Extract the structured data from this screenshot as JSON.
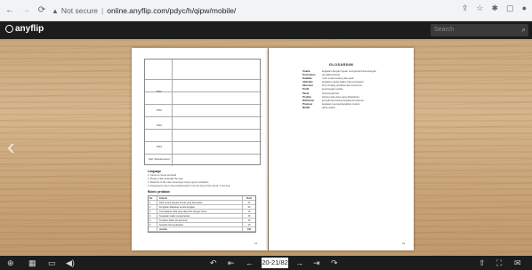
{
  "browser": {
    "security_label": "Not secure",
    "url": "online.anyflip.com/pdyc/h/qipw/mobile/"
  },
  "app": {
    "logo_text": "anyflip",
    "search_placeholder": "Search"
  },
  "book": {
    "left_page": {
      "row_labels": [
        "PS1",
        "PS2",
        "PS3",
        "PS4",
        "Rel. Requirement"
      ],
      "section_heading": "Language",
      "list_items": [
        "1. Carnet a course and lead",
        "2. Please make wnatually the task",
        "3. Read the to the rules stereotype using a given evaluation",
        "4. Assessment note to the portfolio basin to the the time of the record. In the time"
      ],
      "rubric_heading": "Rubric penilaian",
      "rubric_header": [
        "No",
        "Kriteria",
        "Point"
      ],
      "rubric_rows": [
        [
          "1",
          "Data sesuai dengan format yang ditentukan",
          "20"
        ],
        [
          "2",
          "Pengisian dilakukan secara lengkap",
          "20"
        ],
        [
          "3",
          "Kelengkapan data yang diperoleh dengan benar",
          "15"
        ],
        [
          "4",
          "Ketepatan waktu pengumpulan",
          "15"
        ],
        [
          "5",
          "Kerapian dalam penyusunan",
          "15"
        ],
        [
          "6",
          "Keaslian hasil pekerjaan",
          "15"
        ],
        [
          "",
          "Jumlah",
          "100"
        ]
      ],
      "page_number": "21"
    },
    "right_page": {
      "title": "GLOSARIUM",
      "glossary": [
        [
          "Usaha",
          "kegiatan dengan tujuan memperoleh keuntungan"
        ],
        [
          "Konsumen",
          "pemakai barang"
        ],
        [
          "Kualitas",
          "mutu suatu barang atau jasa"
        ],
        [
          "Aktivitas",
          "kegiatan usaha dalam hal pemasaran"
        ],
        [
          "Ekonomi",
          "ilmu tentang produksi dan konsumsi"
        ],
        [
          "Profit",
          "keuntungan usaha"
        ],
        [
          "Pasar",
          "tempat jual beli"
        ],
        [
          "Produk",
          "barang atau jasa yang ditawarkan"
        ],
        [
          "Distribusi",
          "penyaluran barang kepada konsumen"
        ],
        [
          "Promosi",
          "kegiatan memperkenalkan produk"
        ],
        [
          "Modal",
          "dana usaha"
        ]
      ],
      "page_number": "22"
    }
  },
  "toolbar": {
    "page_indicator": "20-21/82"
  }
}
